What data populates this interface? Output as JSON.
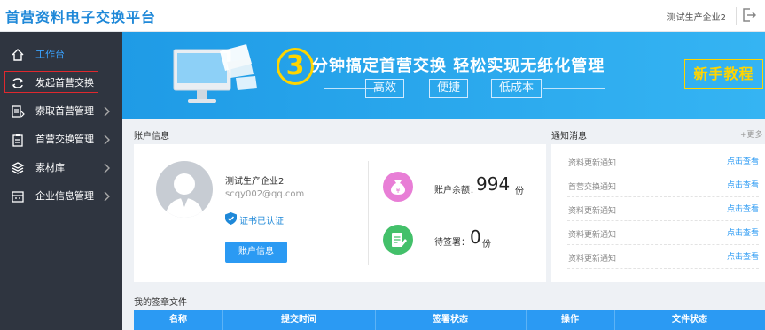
{
  "header": {
    "brand": "首营资料电子交换平台",
    "user": "测试生产企业2",
    "logout_icon": "logout-icon"
  },
  "sidebar": {
    "items": [
      {
        "label": "工作台",
        "icon": "home-icon",
        "active": true
      },
      {
        "label": "发起首营交换",
        "icon": "exchange-icon"
      },
      {
        "label": "索取首营管理",
        "icon": "request-icon"
      },
      {
        "label": "首营交换管理",
        "icon": "clipboard-icon"
      },
      {
        "label": "素材库",
        "icon": "layers-icon"
      },
      {
        "label": "企业信息管理",
        "icon": "building-icon"
      }
    ]
  },
  "banner": {
    "number": "3",
    "headline": "分钟搞定首营交换  轻松实现无纸化管理",
    "tags": [
      "高效",
      "便捷",
      "低成本"
    ],
    "tutorial": "新手教程"
  },
  "account": {
    "section_title": "账户信息",
    "name": "测试生产企业2",
    "email": "scqy002@qq.com",
    "cert": "证书已认证",
    "button": "账户信息",
    "balance_label": "账户余额：",
    "balance_value": "994",
    "balance_unit": "份",
    "pending_label": "待签署：",
    "pending_value": "0",
    "pending_unit": "份"
  },
  "notices": {
    "section_title": "通知消息",
    "more": "+更多",
    "items": [
      {
        "title": "资料更新通知",
        "link": "点击查看"
      },
      {
        "title": "首营交换通知",
        "link": "点击查看"
      },
      {
        "title": "资料更新通知",
        "link": "点击查看"
      },
      {
        "title": "资料更新通知",
        "link": "点击查看"
      },
      {
        "title": "资料更新通知",
        "link": "点击查看"
      }
    ]
  },
  "files": {
    "section_title": "我的签章文件",
    "columns": [
      "名称",
      "提交时间",
      "签署状态",
      "操作",
      "文件状态"
    ]
  },
  "colors": {
    "primary": "#2b9af3",
    "sidebar": "#2f3540",
    "accent": "#ffd500",
    "highlight": "#e0282e"
  }
}
